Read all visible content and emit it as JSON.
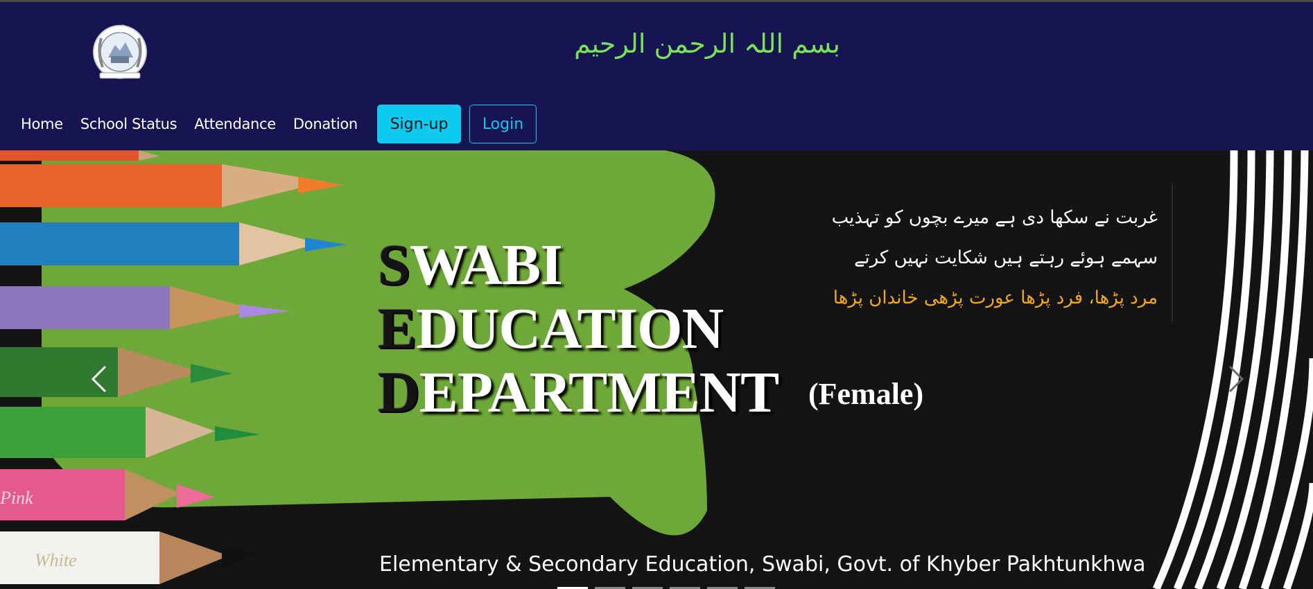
{
  "header": {
    "basmala": "بسم اللہ الرحمن الرحیم",
    "logo_icon": "khyber-pakhtunkhwa-emblem",
    "background_color": "#161451",
    "basmala_color": "#7be05a"
  },
  "nav": {
    "links": [
      "Home",
      "School Status",
      "Attendance",
      "Donation"
    ],
    "signup_label": "Sign-up",
    "login_label": "Login",
    "accent_color": "#0dcaf0"
  },
  "hero": {
    "title_lines": [
      {
        "cap": "S",
        "rest": "WABI"
      },
      {
        "cap": "E",
        "rest": "DUCATION"
      },
      {
        "cap": "D",
        "rest": "EPARTMENT"
      }
    ],
    "subtitle": "(Female)",
    "urdu_lines": [
      "غربت نے سکھا دی ہے میرے بچوں کو تہذیب",
      "سہمے ہوئے رہتے ہیں شکایت نہیں کرتے",
      "مرد پڑھا، فرد پڑھا    عورت پڑھی خاندان پڑھا"
    ],
    "caption": "Elementary & Secondary Education, Swabi, Govt. of Khyber Pakhtunkhwa",
    "prev_icon": "chevron-left-icon",
    "next_icon": "chevron-right-icon",
    "indicators_count": 6,
    "active_indicator": 1,
    "green_color": "#6ea838",
    "gold_color": "#f0a81e"
  }
}
